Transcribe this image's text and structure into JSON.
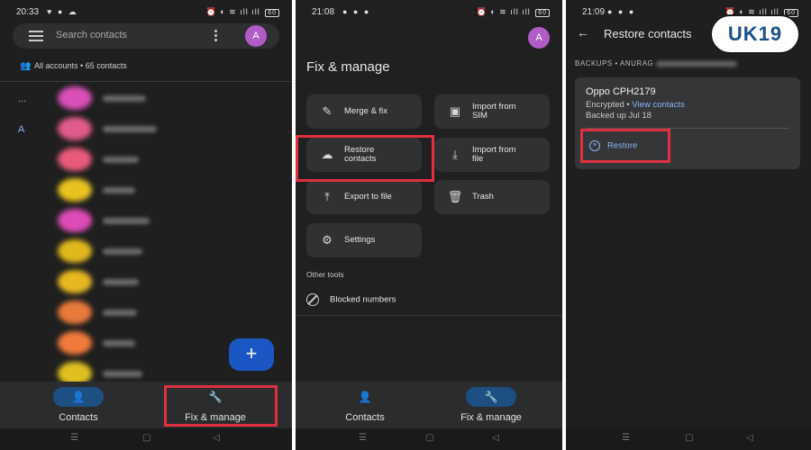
{
  "screens": [
    {
      "status": {
        "time": "20:33",
        "battery": "60"
      },
      "search": {
        "placeholder": "Search contacts"
      },
      "avatar_letter": "A",
      "accounts_label": "All accounts • 65 contacts",
      "section_letters": [
        "...",
        "A"
      ],
      "nav": {
        "contacts_label": "Contacts",
        "fix_label": "Fix & manage"
      }
    },
    {
      "status": {
        "time": "21:08",
        "battery": "60"
      },
      "avatar_letter": "A",
      "title": "Fix & manage",
      "cards": [
        {
          "label": "Merge & fix",
          "icon": "magic-wand-icon"
        },
        {
          "label_1": "Import from",
          "label_2": "SIM",
          "icon": "import-sim-icon"
        },
        {
          "label_1": "Restore",
          "label_2": "contacts",
          "icon": "cloud-restore-icon"
        },
        {
          "label_1": "Import from",
          "label_2": "file",
          "icon": "import-file-icon"
        },
        {
          "label": "Export to file",
          "icon": "export-icon"
        },
        {
          "label": "Trash",
          "icon": "trash-icon"
        },
        {
          "label": "Settings",
          "icon": "gear-icon"
        }
      ],
      "other_tools": "Other tools",
      "blocked": "Blocked numbers",
      "nav": {
        "contacts_label": "Contacts",
        "fix_label": "Fix & manage"
      }
    },
    {
      "status": {
        "time": "21:09",
        "battery": "60"
      },
      "title": "Restore contacts",
      "backups_label": "BACKUPS • ANURAG",
      "logo_text": "UK19",
      "backup": {
        "device": "Oppo CPH2179",
        "encrypted": "Encrypted •",
        "view_contacts": "View contacts",
        "backed_up": "Backed up Jul 18",
        "restore_label": "Restore"
      }
    }
  ],
  "colors": {
    "highlight": "#e0303f",
    "accent": "#8ab4f8",
    "fab": "#1a56c4",
    "avatar": "#b05cc7"
  },
  "contact_colors": [
    "#d94fb8",
    "#e05a8a",
    "#e85a7a",
    "#e8c21e",
    "#dc4cb6",
    "#e0b81c",
    "#e8b820",
    "#e87a3a",
    "#f07a3c",
    "#e0c020",
    "#d84aa0",
    "#e8853a"
  ]
}
